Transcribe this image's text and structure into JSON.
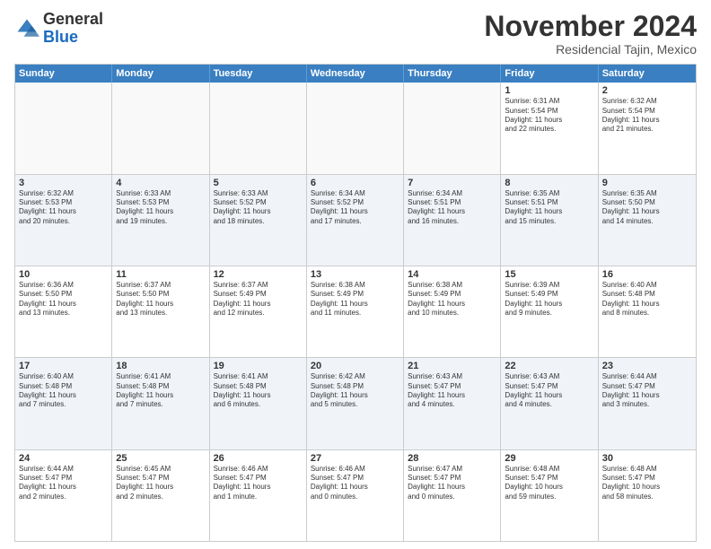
{
  "logo": {
    "general": "General",
    "blue": "Blue"
  },
  "title": "November 2024",
  "subtitle": "Residencial Tajin, Mexico",
  "header_days": [
    "Sunday",
    "Monday",
    "Tuesday",
    "Wednesday",
    "Thursday",
    "Friday",
    "Saturday"
  ],
  "rows": [
    [
      {
        "day": "",
        "text": "",
        "empty": true
      },
      {
        "day": "",
        "text": "",
        "empty": true
      },
      {
        "day": "",
        "text": "",
        "empty": true
      },
      {
        "day": "",
        "text": "",
        "empty": true
      },
      {
        "day": "",
        "text": "",
        "empty": true
      },
      {
        "day": "1",
        "text": "Sunrise: 6:31 AM\nSunset: 5:54 PM\nDaylight: 11 hours\nand 22 minutes.",
        "alt": false
      },
      {
        "day": "2",
        "text": "Sunrise: 6:32 AM\nSunset: 5:54 PM\nDaylight: 11 hours\nand 21 minutes.",
        "alt": false
      }
    ],
    [
      {
        "day": "3",
        "text": "Sunrise: 6:32 AM\nSunset: 5:53 PM\nDaylight: 11 hours\nand 20 minutes.",
        "alt": true
      },
      {
        "day": "4",
        "text": "Sunrise: 6:33 AM\nSunset: 5:53 PM\nDaylight: 11 hours\nand 19 minutes.",
        "alt": true
      },
      {
        "day": "5",
        "text": "Sunrise: 6:33 AM\nSunset: 5:52 PM\nDaylight: 11 hours\nand 18 minutes.",
        "alt": true
      },
      {
        "day": "6",
        "text": "Sunrise: 6:34 AM\nSunset: 5:52 PM\nDaylight: 11 hours\nand 17 minutes.",
        "alt": true
      },
      {
        "day": "7",
        "text": "Sunrise: 6:34 AM\nSunset: 5:51 PM\nDaylight: 11 hours\nand 16 minutes.",
        "alt": true
      },
      {
        "day": "8",
        "text": "Sunrise: 6:35 AM\nSunset: 5:51 PM\nDaylight: 11 hours\nand 15 minutes.",
        "alt": true
      },
      {
        "day": "9",
        "text": "Sunrise: 6:35 AM\nSunset: 5:50 PM\nDaylight: 11 hours\nand 14 minutes.",
        "alt": true
      }
    ],
    [
      {
        "day": "10",
        "text": "Sunrise: 6:36 AM\nSunset: 5:50 PM\nDaylight: 11 hours\nand 13 minutes.",
        "alt": false
      },
      {
        "day": "11",
        "text": "Sunrise: 6:37 AM\nSunset: 5:50 PM\nDaylight: 11 hours\nand 13 minutes.",
        "alt": false
      },
      {
        "day": "12",
        "text": "Sunrise: 6:37 AM\nSunset: 5:49 PM\nDaylight: 11 hours\nand 12 minutes.",
        "alt": false
      },
      {
        "day": "13",
        "text": "Sunrise: 6:38 AM\nSunset: 5:49 PM\nDaylight: 11 hours\nand 11 minutes.",
        "alt": false
      },
      {
        "day": "14",
        "text": "Sunrise: 6:38 AM\nSunset: 5:49 PM\nDaylight: 11 hours\nand 10 minutes.",
        "alt": false
      },
      {
        "day": "15",
        "text": "Sunrise: 6:39 AM\nSunset: 5:49 PM\nDaylight: 11 hours\nand 9 minutes.",
        "alt": false
      },
      {
        "day": "16",
        "text": "Sunrise: 6:40 AM\nSunset: 5:48 PM\nDaylight: 11 hours\nand 8 minutes.",
        "alt": false
      }
    ],
    [
      {
        "day": "17",
        "text": "Sunrise: 6:40 AM\nSunset: 5:48 PM\nDaylight: 11 hours\nand 7 minutes.",
        "alt": true
      },
      {
        "day": "18",
        "text": "Sunrise: 6:41 AM\nSunset: 5:48 PM\nDaylight: 11 hours\nand 7 minutes.",
        "alt": true
      },
      {
        "day": "19",
        "text": "Sunrise: 6:41 AM\nSunset: 5:48 PM\nDaylight: 11 hours\nand 6 minutes.",
        "alt": true
      },
      {
        "day": "20",
        "text": "Sunrise: 6:42 AM\nSunset: 5:48 PM\nDaylight: 11 hours\nand 5 minutes.",
        "alt": true
      },
      {
        "day": "21",
        "text": "Sunrise: 6:43 AM\nSunset: 5:47 PM\nDaylight: 11 hours\nand 4 minutes.",
        "alt": true
      },
      {
        "day": "22",
        "text": "Sunrise: 6:43 AM\nSunset: 5:47 PM\nDaylight: 11 hours\nand 4 minutes.",
        "alt": true
      },
      {
        "day": "23",
        "text": "Sunrise: 6:44 AM\nSunset: 5:47 PM\nDaylight: 11 hours\nand 3 minutes.",
        "alt": true
      }
    ],
    [
      {
        "day": "24",
        "text": "Sunrise: 6:44 AM\nSunset: 5:47 PM\nDaylight: 11 hours\nand 2 minutes.",
        "alt": false
      },
      {
        "day": "25",
        "text": "Sunrise: 6:45 AM\nSunset: 5:47 PM\nDaylight: 11 hours\nand 2 minutes.",
        "alt": false
      },
      {
        "day": "26",
        "text": "Sunrise: 6:46 AM\nSunset: 5:47 PM\nDaylight: 11 hours\nand 1 minute.",
        "alt": false
      },
      {
        "day": "27",
        "text": "Sunrise: 6:46 AM\nSunset: 5:47 PM\nDaylight: 11 hours\nand 0 minutes.",
        "alt": false
      },
      {
        "day": "28",
        "text": "Sunrise: 6:47 AM\nSunset: 5:47 PM\nDaylight: 11 hours\nand 0 minutes.",
        "alt": false
      },
      {
        "day": "29",
        "text": "Sunrise: 6:48 AM\nSunset: 5:47 PM\nDaylight: 10 hours\nand 59 minutes.",
        "alt": false
      },
      {
        "day": "30",
        "text": "Sunrise: 6:48 AM\nSunset: 5:47 PM\nDaylight: 10 hours\nand 58 minutes.",
        "alt": false
      }
    ]
  ]
}
